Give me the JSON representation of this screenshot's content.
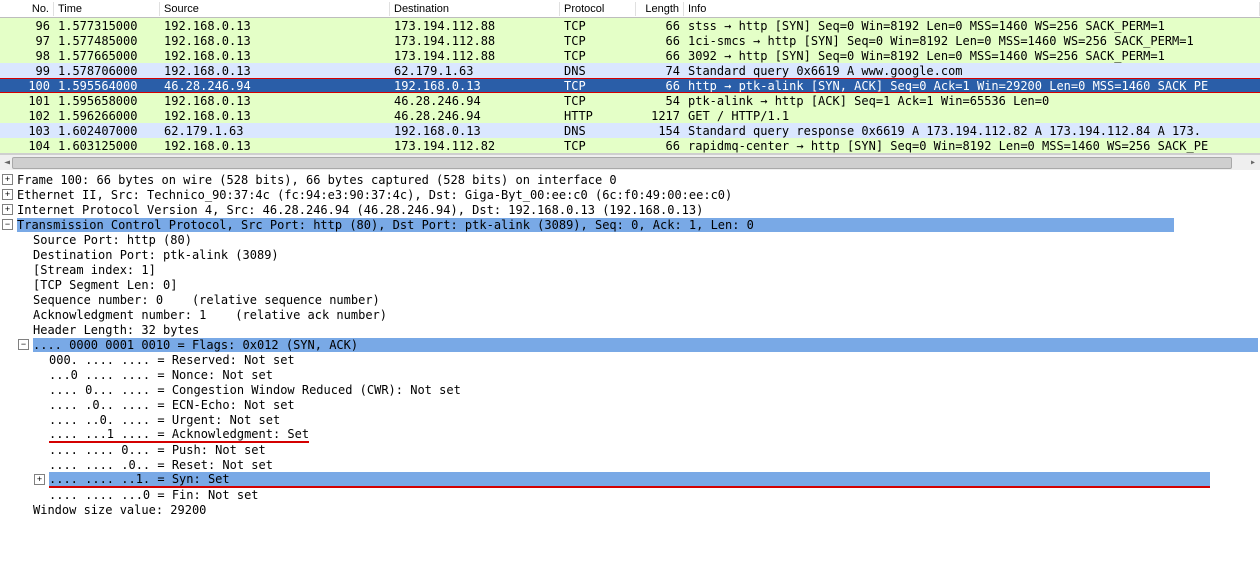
{
  "columns": {
    "no": "No.",
    "time": "Time",
    "source": "Source",
    "dest": "Destination",
    "proto": "Protocol",
    "len": "Length",
    "info": "Info"
  },
  "packets": [
    {
      "no": "96",
      "time": "1.577315000",
      "src": "192.168.0.13",
      "dst": "173.194.112.88",
      "proto": "TCP",
      "len": "66",
      "info": "stss → http [SYN] Seq=0 Win=8192 Len=0 MSS=1460 WS=256 SACK_PERM=1",
      "cls": "row-green"
    },
    {
      "no": "97",
      "time": "1.577485000",
      "src": "192.168.0.13",
      "dst": "173.194.112.88",
      "proto": "TCP",
      "len": "66",
      "info": "1ci-smcs → http [SYN] Seq=0 Win=8192 Len=0 MSS=1460 WS=256 SACK_PERM=1",
      "cls": "row-green"
    },
    {
      "no": "98",
      "time": "1.577665000",
      "src": "192.168.0.13",
      "dst": "173.194.112.88",
      "proto": "TCP",
      "len": "66",
      "info": "3092 → http [SYN] Seq=0 Win=8192 Len=0 MSS=1460 WS=256 SACK_PERM=1",
      "cls": "row-green"
    },
    {
      "no": "99",
      "time": "1.578706000",
      "src": "192.168.0.13",
      "dst": "62.179.1.63",
      "proto": "DNS",
      "len": "74",
      "info": "Standard query 0x6619  A www.google.com",
      "cls": "row-blue"
    },
    {
      "no": "100",
      "time": "1.595564000",
      "src": "46.28.246.94",
      "dst": "192.168.0.13",
      "proto": "TCP",
      "len": "66",
      "info": "http → ptk-alink [SYN, ACK] Seq=0 Ack=1 Win=29200 Len=0 MSS=1460 SACK_PE",
      "cls": "row-selected row-marked"
    },
    {
      "no": "101",
      "time": "1.595658000",
      "src": "192.168.0.13",
      "dst": "46.28.246.94",
      "proto": "TCP",
      "len": "54",
      "info": "ptk-alink → http [ACK] Seq=1 Ack=1 Win=65536 Len=0",
      "cls": "row-green"
    },
    {
      "no": "102",
      "time": "1.596266000",
      "src": "192.168.0.13",
      "dst": "46.28.246.94",
      "proto": "HTTP",
      "len": "1217",
      "info": "GET / HTTP/1.1",
      "cls": "row-green"
    },
    {
      "no": "103",
      "time": "1.602407000",
      "src": "62.179.1.63",
      "dst": "192.168.0.13",
      "proto": "DNS",
      "len": "154",
      "info": "Standard query response 0x6619  A 173.194.112.82 A 173.194.112.84 A 173.",
      "cls": "row-blue"
    },
    {
      "no": "104",
      "time": "1.603125000",
      "src": "192.168.0.13",
      "dst": "173.194.112.82",
      "proto": "TCP",
      "len": "66",
      "info": "rapidmq-center → http [SYN] Seq=0 Win=8192 Len=0 MSS=1460 WS=256 SACK_PE",
      "cls": "row-green"
    }
  ],
  "details": {
    "l0": [
      {
        "tw": "+",
        "txt": "Frame 100: 66 bytes on wire (528 bits), 66 bytes captured (528 bits) on interface 0"
      },
      {
        "tw": "+",
        "txt": "Ethernet II, Src: Technico_90:37:4c (fc:94:e3:90:37:4c), Dst: Giga-Byt_00:ee:c0 (6c:f0:49:00:ee:c0)"
      },
      {
        "tw": "+",
        "txt": "Internet Protocol Version 4, Src: 46.28.246.94 (46.28.246.94), Dst: 192.168.0.13 (192.168.0.13)"
      },
      {
        "tw": "-",
        "txt": "Transmission Control Protocol, Src Port: http (80), Dst Port: ptk-alink (3089), Seq: 0, Ack: 1, Len: 0",
        "hl": true
      }
    ],
    "l1": [
      "Source Port: http (80)",
      "Destination Port: ptk-alink (3089)",
      "[Stream index: 1]",
      "[TCP Segment Len: 0]",
      "Sequence number: 0    (relative sequence number)",
      "Acknowledgment number: 1    (relative ack number)",
      "Header Length: 32 bytes"
    ],
    "flagsHeader": ".... 0000 0001 0010 = Flags: 0x012 (SYN, ACK)",
    "flagBits": [
      {
        "txt": "000. .... .... = Reserved: Not set"
      },
      {
        "txt": "...0 .... .... = Nonce: Not set"
      },
      {
        "txt": ".... 0... .... = Congestion Window Reduced (CWR): Not set"
      },
      {
        "txt": ".... .0.. .... = ECN-Echo: Not set"
      },
      {
        "txt": ".... ..0. .... = Urgent: Not set"
      },
      {
        "txt": ".... ...1 .... = Acknowledgment: Set",
        "ul": true
      },
      {
        "txt": ".... .... 0... = Push: Not set"
      },
      {
        "txt": ".... .... .0.. = Reset: Not set"
      },
      {
        "txt": ".... .... ..1. = Syn: Set",
        "ul": true,
        "tw": "+",
        "hl": true
      },
      {
        "txt": ".... .... ...0 = Fin: Not set"
      }
    ],
    "tail": "Window size value: 29200"
  }
}
